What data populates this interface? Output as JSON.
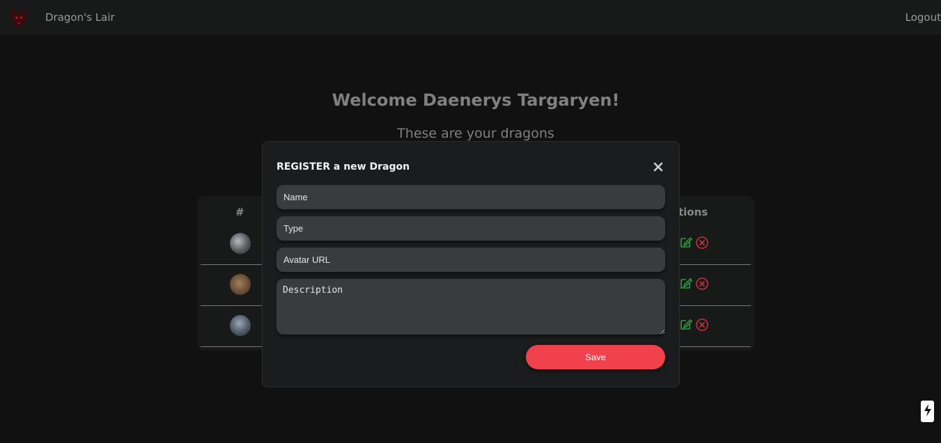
{
  "navbar": {
    "brand": "Dragon's Lair",
    "logout_label": "Logout",
    "logo_icon": "dragon-head-icon"
  },
  "main": {
    "welcome": "Welcome Daenerys Targaryen!",
    "subtitle": "These are your dragons"
  },
  "table": {
    "header_hash": "#",
    "header_actions": "tions",
    "rows": [
      {
        "avatar_color": "#6c6f73"
      },
      {
        "avatar_color": "#7a6248"
      },
      {
        "avatar_color": "#5a6572"
      }
    ]
  },
  "modal": {
    "title": "REGISTER a new Dragon",
    "name_placeholder": "Name",
    "type_placeholder": "Type",
    "avatar_placeholder": "Avatar URL",
    "description_placeholder": "Description",
    "save_label": "Save"
  },
  "colors": {
    "accent": "#f0414d",
    "edit": "#2e9a3e",
    "delete": "#c8323a",
    "background": "#111111",
    "modal_bg": "#1b1c1d"
  }
}
